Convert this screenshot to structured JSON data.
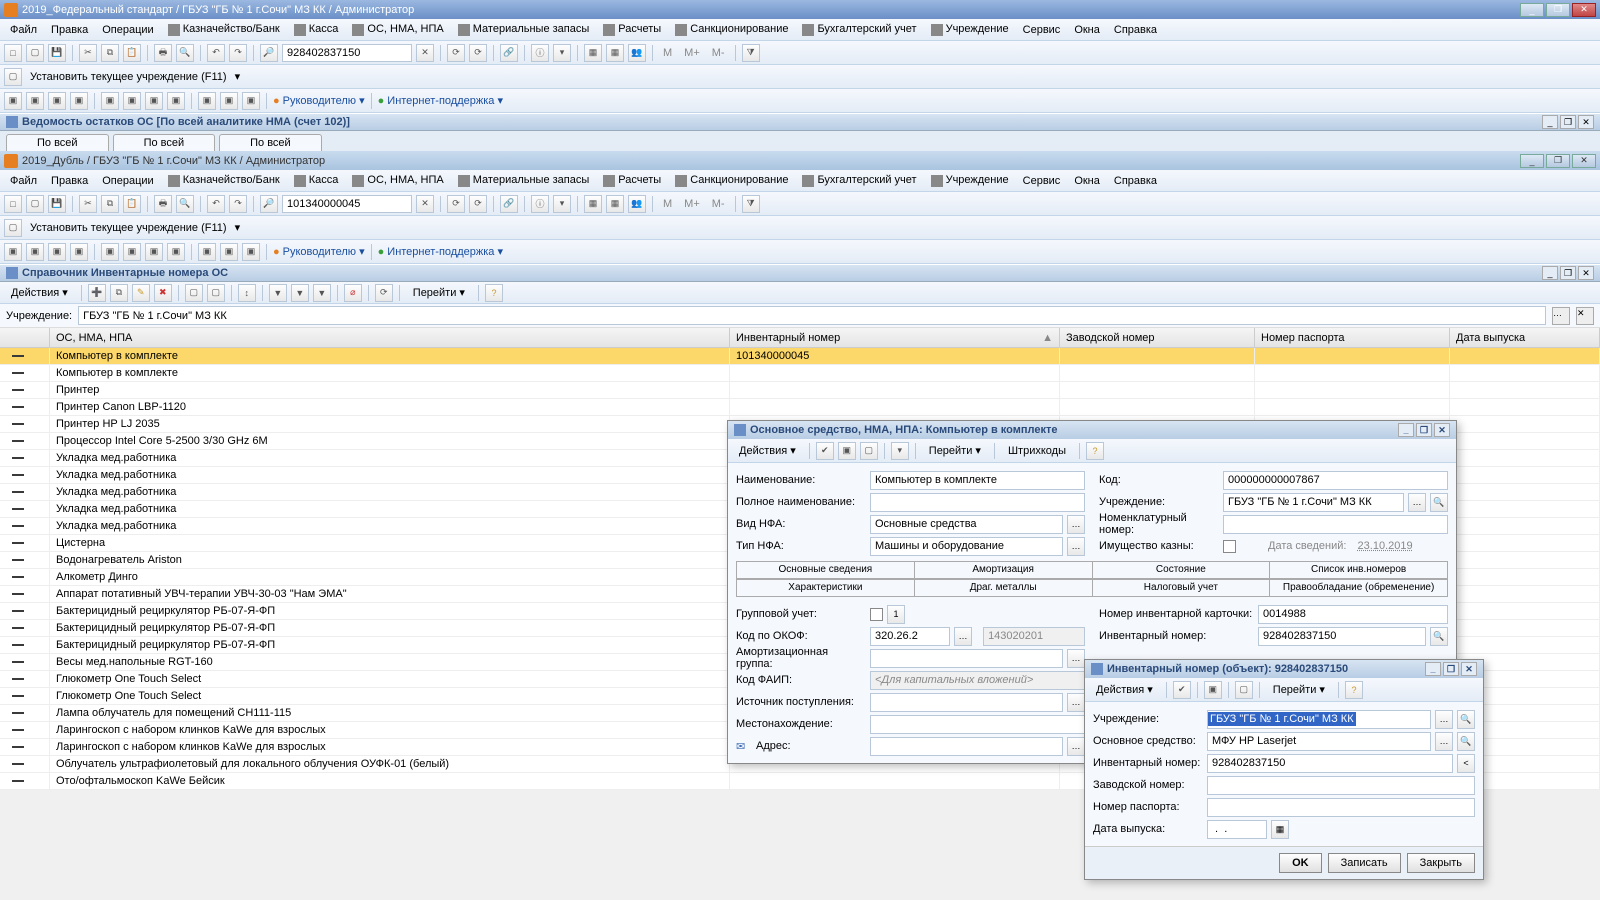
{
  "window1": {
    "title": "2019_Федеральный стандарт / ГБУЗ \"ГБ № 1  г.Сочи\" МЗ КК / Администратор",
    "searchValue": "928402837150"
  },
  "window2": {
    "title": "2019_Дубль / ГБУЗ \"ГБ № 1  г.Сочи\" МЗ КК / Администратор",
    "searchValue": "101340000045"
  },
  "menu": {
    "file": "Файл",
    "edit": "Правка",
    "operations": "Операции",
    "treasury": "Казначейство/Банк",
    "kassa": "Касса",
    "osnma": "ОС, НМА, НПА",
    "material": "Материальные запасы",
    "calc": "Расчеты",
    "sanc": "Санкционирование",
    "accounting": "Бухгалтерский учет",
    "institution": "Учреждение",
    "service": "Сервис",
    "windows": "Окна",
    "help": "Справка"
  },
  "toolbar": {
    "setInstitution": "Установить текущее учреждение (F11)",
    "leader": "Руководителю",
    "support": "Интернет-поддержка",
    "m": "М",
    "mplus": "М+",
    "mminus": "М-"
  },
  "subheader1": {
    "title": "Ведомость остатков ОС [По всей аналитике НМА (счет 102)]",
    "tab": "По всей"
  },
  "ref": {
    "title": "Справочник Инвентарные номера ОС",
    "actions": "Действия",
    "go": "Перейти",
    "institutionLabel": "Учреждение:",
    "institutionValue": "ГБУЗ \"ГБ № 1 г.Сочи\" МЗ КК",
    "cols": {
      "name": "ОС, НМА, НПА",
      "inv": "Инвентарный номер",
      "factory": "Заводской номер",
      "passport": "Номер паспорта",
      "release": "Дата выпуска"
    },
    "rows": [
      {
        "name": "Компьютер в комплекте",
        "inv": "101340000045",
        "selected": true
      },
      {
        "name": "Компьютер в комплекте"
      },
      {
        "name": "Принтер"
      },
      {
        "name": "Принтер Canon LBP-1120"
      },
      {
        "name": "Принтер HP LJ 2035"
      },
      {
        "name": "Процессор Intel Core 5-2500 3/30 GHz 6M"
      },
      {
        "name": "Укладка мед.работника"
      },
      {
        "name": "Укладка мед.работника"
      },
      {
        "name": "Укладка мед.работника"
      },
      {
        "name": "Укладка мед.работника"
      },
      {
        "name": "Укладка мед.работника"
      },
      {
        "name": "Цистерна"
      },
      {
        "name": "Водонагреватель Ariston"
      },
      {
        "name": "Алкометр Динго"
      },
      {
        "name": "Аппарат потативный УВЧ-терапии УВЧ-30-03 \"Нам ЭМА\""
      },
      {
        "name": "Бактерицидный рециркулятор РБ-07-Я-ФП"
      },
      {
        "name": "Бактерицидный рециркулятор РБ-07-Я-ФП"
      },
      {
        "name": "Бактерицидный рециркулятор РБ-07-Я-ФП"
      },
      {
        "name": "Весы мед.напольные RGT-160"
      },
      {
        "name": "Глюкометр One Touch Select"
      },
      {
        "name": "Глюкометр One Touch Select"
      },
      {
        "name": "Лампа облучатель для помещений СН111-115"
      },
      {
        "name": "Ларингоскоп с набором клинков KaWe для взрослых"
      },
      {
        "name": "Ларингоскоп с набором клинков KaWe для взрослых"
      },
      {
        "name": "Облучатель ультрафиолетовый для локального облучения ОУФК-01 (белый)"
      },
      {
        "name": "Ото/офтальмоскоп KaWe Бейсик"
      }
    ]
  },
  "card": {
    "title": "Основное средство, НМА, НПА: Компьютер в комплекте",
    "actions": "Действия",
    "go": "Перейти",
    "barcodes": "Штрихкоды",
    "labels": {
      "name": "Наименование:",
      "fullName": "Полное наименование:",
      "vidNFA": "Вид НФА:",
      "tipNFA": "Тип НФА:",
      "code": "Код:",
      "institution": "Учреждение:",
      "nomNum": "Номенклатурный номер:",
      "treasury": "Имущество казны:",
      "dataSved": "Дата сведений:",
      "group": "Групповой учет:",
      "okof": "Код по ОКОФ:",
      "amort": "Амортизационная группа:",
      "faip": "Код ФАИП:",
      "source": "Источник поступления:",
      "location": "Местонахождение:",
      "address": "Адрес:",
      "cardNum": "Номер инвентарной карточки:",
      "invNum": "Инвентарный номер:"
    },
    "vals": {
      "name": "Компьютер в комплекте",
      "vidNFA": "Основные средства",
      "tipNFA": "Машины и оборудование",
      "code": "000000000007867",
      "institution": "ГБУЗ \"ГБ № 1 г.Сочи\" МЗ КК",
      "okof1": "320.26.2",
      "okof2": "143020201",
      "faipPlaceholder": "<Для капитальных вложений>",
      "cardNum": "0014988",
      "invNum": "928402837150",
      "dataSved": "23.10.2019"
    },
    "tabs": {
      "basic": "Основные сведения",
      "amort": "Амортизация",
      "state": "Состояние",
      "invList": "Список инв.номеров",
      "chars": "Характеристики",
      "metals": "Драг. металлы",
      "tax": "Налоговый учет",
      "rights": "Правообладание (обременение)"
    }
  },
  "invDlg": {
    "title": "Инвентарный номер (объект): 928402837150",
    "actions": "Действия",
    "go": "Перейти",
    "labels": {
      "institution": "Учреждение:",
      "asset": "Основное средство:",
      "invNum": "Инвентарный номер:",
      "factory": "Заводской номер:",
      "passport": "Номер паспорта:",
      "release": "Дата выпуска:"
    },
    "vals": {
      "institution": "ГБУЗ \"ГБ № 1 г.Сочи\" МЗ КК",
      "asset": "МФУ HP Laserjet",
      "invNum": "928402837150",
      "datePlaceholder": " .  .  "
    },
    "buttons": {
      "ok": "OK",
      "save": "Записать",
      "close": "Закрыть"
    }
  }
}
